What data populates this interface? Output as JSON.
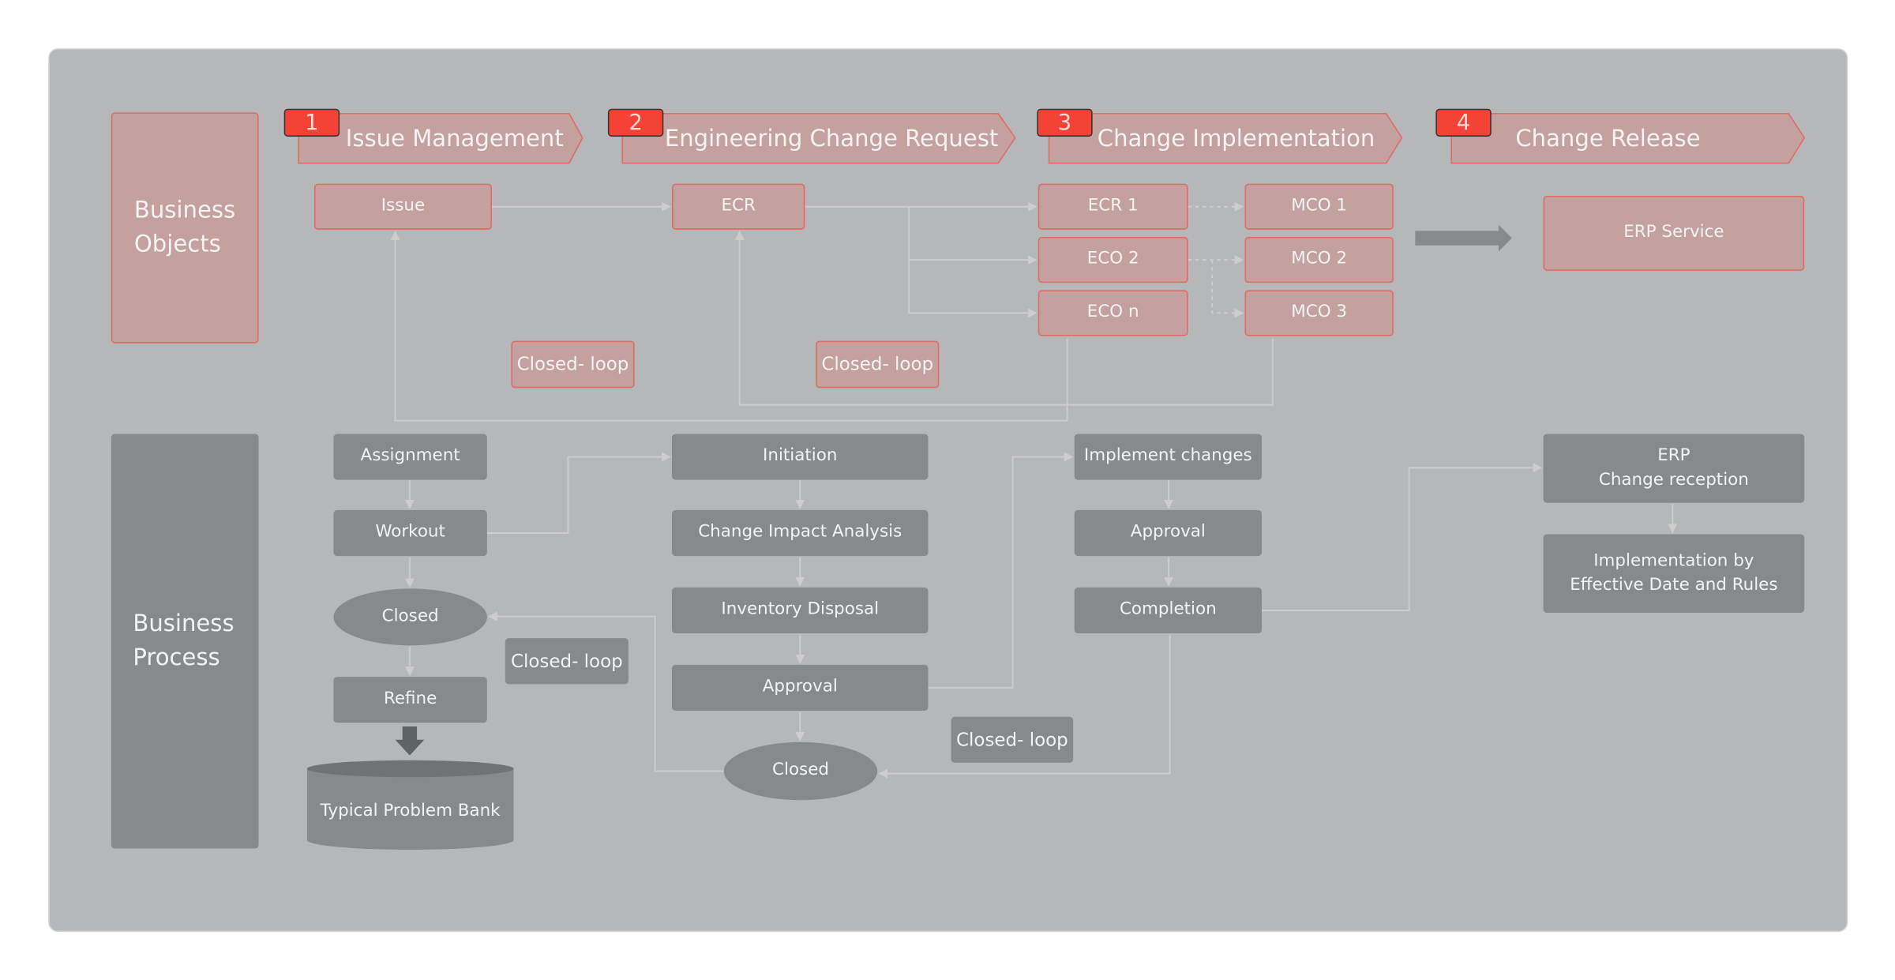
{
  "rows": {
    "objects": "Business Objects",
    "process": "Business Process"
  },
  "stages": [
    {
      "num": "1",
      "title": "Issue Management"
    },
    {
      "num": "2",
      "title": "Engineering Change Request"
    },
    {
      "num": "3",
      "title": "Change Implementation"
    },
    {
      "num": "4",
      "title": "Change Release"
    }
  ],
  "objects": {
    "issue": "Issue",
    "ecr": "ECR",
    "ecr1": "ECR 1",
    "eco2": "ECO 2",
    "econ": "ECO n",
    "mco1": "MCO 1",
    "mco2": "MCO 2",
    "mco3": "MCO 3",
    "erp": "ERP Service",
    "loop1": "Closed- loop",
    "loop2": "Closed- loop"
  },
  "process": {
    "assignment": "Assignment",
    "workout": "Workout",
    "closed1": "Closed",
    "refine": "Refine",
    "bank": "Typical Problem Bank",
    "loop1": "Closed- loop",
    "initiation": "Initiation",
    "impact": "Change Impact Analysis",
    "inventory": "Inventory Disposal",
    "approval1": "Approval",
    "closed2": "Closed",
    "loop2": "Closed- loop",
    "implement": "Implement changes",
    "approval2": "Approval",
    "completion": "Completion",
    "erp_reception": "ERP\nChange reception",
    "implementation": "Implementation by\nEffective Date and Rules"
  },
  "colors": {
    "panel": "#b6b7b8",
    "object_fill": "#c4a09e",
    "object_border": "#e06a64",
    "process_fill": "#868a8d",
    "badge": "#f44336",
    "connector": "#cdcdcd"
  }
}
